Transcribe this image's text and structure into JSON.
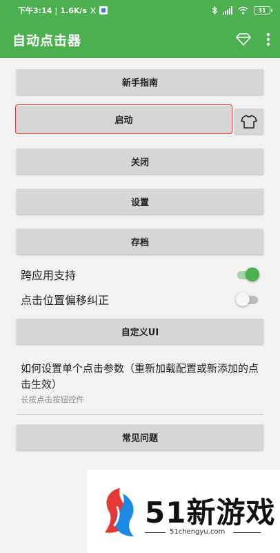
{
  "status_bar": {
    "time": "下午3:14",
    "speed": "1.6K/s",
    "battery": "31"
  },
  "app_bar": {
    "title": "自动点击器",
    "icons": [
      "diamond-icon",
      "more-vert-icon"
    ]
  },
  "buttons": {
    "guide": "新手指南",
    "start": "启动",
    "close": "关闭",
    "settings": "设置",
    "archive": "存档",
    "custom_ui": "自定义UI",
    "faq": "常见问题"
  },
  "switches": {
    "cross_app": {
      "label": "跨应用支持",
      "on": true
    },
    "offset_fix": {
      "label": "点击位置偏移纠正",
      "on": false
    }
  },
  "help": {
    "title": "如何设置单个点击参数（重新加载配置或新添加的点击生效）",
    "subtitle": "长按点击按钮控件"
  },
  "watermark": {
    "brand": "51新游戏",
    "url": "51chengyu.com"
  },
  "colors": {
    "primary": "#4caf50",
    "button": "#d6d6d6",
    "highlight": "#e53935"
  }
}
